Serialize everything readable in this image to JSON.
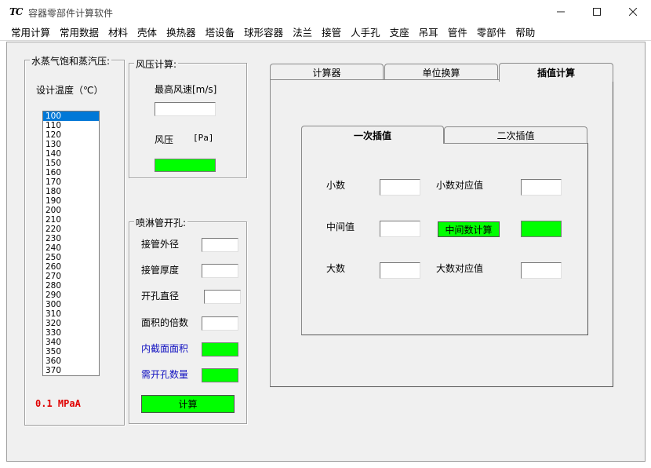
{
  "window": {
    "icon_text": "TC",
    "title": "容器零部件计算软件"
  },
  "menu": [
    "常用计算",
    "常用数据",
    "材料",
    "壳体",
    "换热器",
    "塔设备",
    "球形容器",
    "法兰",
    "接管",
    "人手孔",
    "支座",
    "吊耳",
    "管件",
    "零部件",
    "帮助"
  ],
  "steam": {
    "legend": "水蒸气饱和蒸汽压:",
    "temp_label": "设计温度（℃）",
    "temperatures": [
      "100",
      "110",
      "120",
      "130",
      "140",
      "150",
      "160",
      "170",
      "180",
      "190",
      "200",
      "210",
      "220",
      "230",
      "240",
      "250",
      "260",
      "270",
      "280",
      "290",
      "300",
      "310",
      "320",
      "330",
      "340",
      "350",
      "360",
      "370"
    ],
    "selected": "100",
    "result": "0.1 MPaA"
  },
  "wind": {
    "legend": "风压计算:",
    "speed_label": "最高风速[m/s]",
    "speed_value": "",
    "pressure_label": "风压",
    "pressure_unit": "[Pa]"
  },
  "spray": {
    "legend": "喷淋管开孔:",
    "outer_diameter_label": "接管外径",
    "thickness_label": "接管厚度",
    "hole_diameter_label": "开孔直径",
    "area_multiple_label": "面积的倍数",
    "inner_area_label": "内截面面积",
    "hole_count_label": "需开孔数量",
    "calc_button": "计算"
  },
  "tabs": {
    "items": [
      "计算器",
      "单位换算",
      "插值计算"
    ],
    "active": "插值计算"
  },
  "interp": {
    "tabs": [
      "一次插值",
      "二次插值"
    ],
    "active": "一次插值",
    "small_label": "小数",
    "small_value_label": "小数对应值",
    "middle_label": "中间值",
    "middle_button": "中间数计算",
    "large_label": "大数",
    "large_value_label": "大数对应值"
  },
  "colors": {
    "result_green": "#00ff00",
    "status_red": "#e00000",
    "label_blue": "#1010c0",
    "selection_blue": "#0078d7"
  }
}
